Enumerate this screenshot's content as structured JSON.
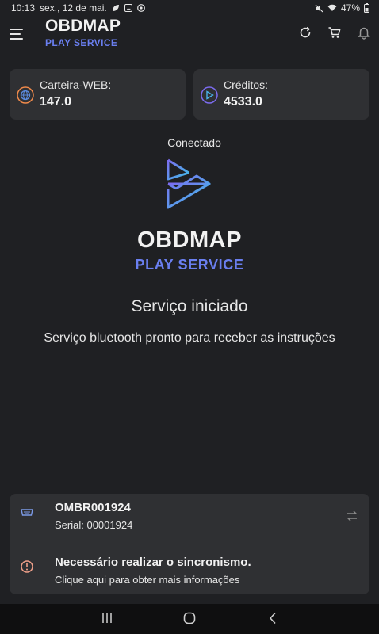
{
  "status_bar": {
    "time": "10:13",
    "date": "sex., 12 de mai.",
    "battery": "47%"
  },
  "app_bar": {
    "title": "OBDMAP",
    "subtitle": "PLAY SERVICE"
  },
  "cards": [
    {
      "label": "Carteira-WEB:",
      "value": "147.0",
      "icon": "globe-icon",
      "color": "#f08a4b"
    },
    {
      "label": "Créditos:",
      "value": "4533.0",
      "icon": "play-credit-icon",
      "color": "#7c6cf0"
    }
  ],
  "connection": {
    "status": "Conectado",
    "line_color": "#3ca86b"
  },
  "hero": {
    "title": "OBDMAP",
    "subtitle": "PLAY SERVICE"
  },
  "service": {
    "title": "Serviço iniciado",
    "message": "Serviço bluetooth pronto para receber as instruções"
  },
  "device": {
    "name": "OMBR001924",
    "serial": "Serial: 00001924",
    "icon": "obd-connector-icon",
    "action_icon": "swap-icon"
  },
  "sync": {
    "title": "Necessário realizar o sincronismo.",
    "subtitle": "Clique aqui para obter mais informações",
    "icon": "alert-circle-icon",
    "color": "#f0a08a"
  },
  "colors": {
    "accent": "#6a7ff0",
    "background": "#1f2023",
    "card": "#2f3033"
  }
}
